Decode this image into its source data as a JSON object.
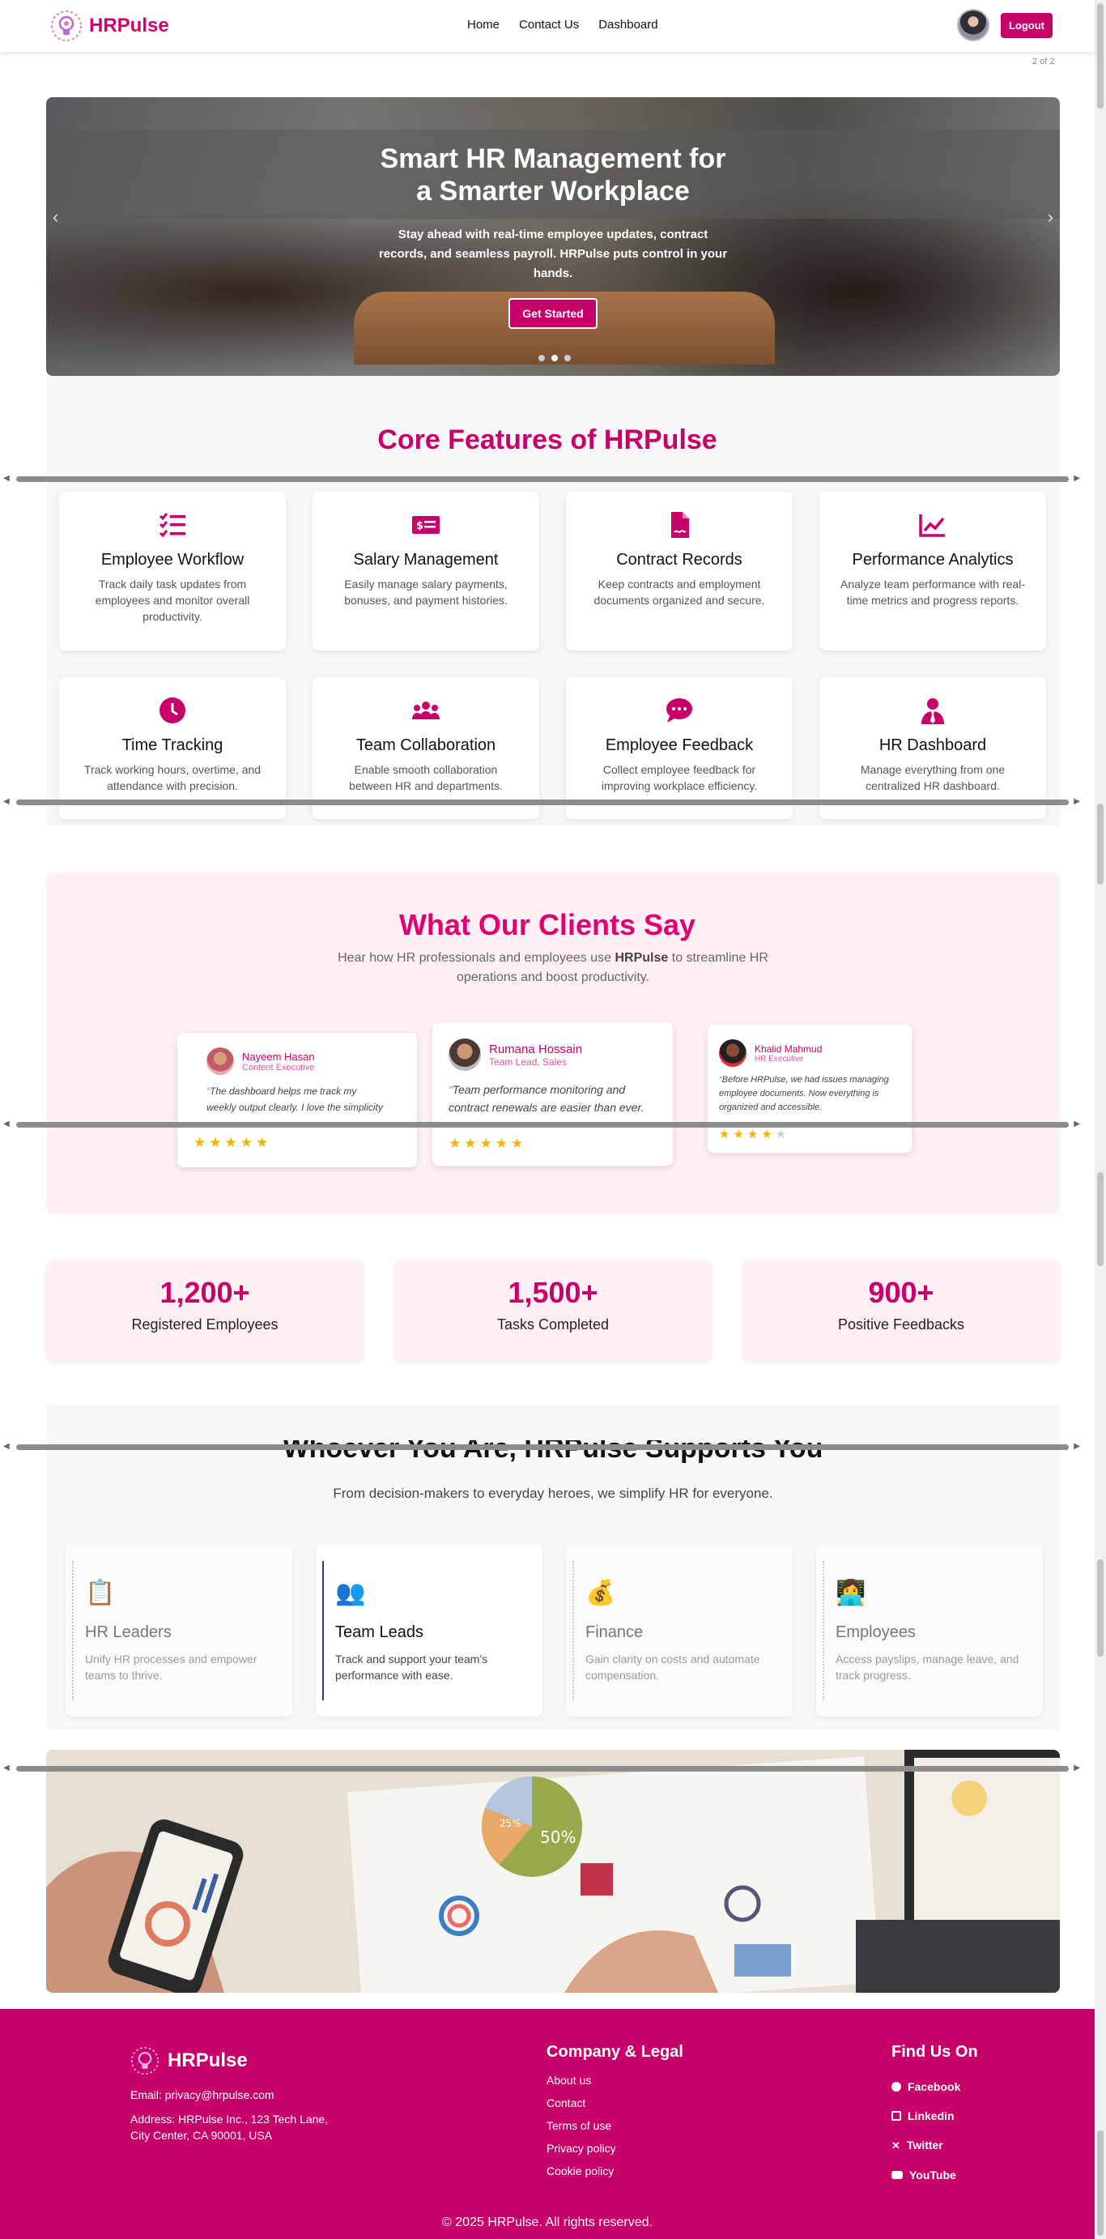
{
  "nav": {
    "brand": "HRPulse",
    "links": [
      "Home",
      "Contact Us",
      "Dashboard"
    ],
    "logout": "Logout",
    "page_indicator": "2 of 2"
  },
  "hero": {
    "title_line1": "Smart HR Management for",
    "title_line2": "a Smarter Workplace",
    "subtitle": "Stay ahead with real-time employee updates, contract records, and seamless payroll. HRPulse puts control in your hands.",
    "cta": "Get Started"
  },
  "features": {
    "title": "Core Features of HRPulse",
    "items": [
      {
        "title": "Employee Workflow",
        "desc": "Track daily task updates from employees and monitor overall productivity.",
        "icon": "tasks-icon"
      },
      {
        "title": "Salary Management",
        "desc": "Easily manage salary payments, bonuses, and payment histories.",
        "icon": "money-check-icon"
      },
      {
        "title": "Contract Records",
        "desc": "Keep contracts and employment documents organized and secure.",
        "icon": "file-contract-icon"
      },
      {
        "title": "Performance Analytics",
        "desc": "Analyze team performance with real-time metrics and progress reports.",
        "icon": "chart-line-icon"
      },
      {
        "title": "Time Tracking",
        "desc": "Track working hours, overtime, and attendance with precision.",
        "icon": "clock-icon"
      },
      {
        "title": "Team Collaboration",
        "desc": "Enable smooth collaboration between HR and departments.",
        "icon": "users-icon"
      },
      {
        "title": "Employee Feedback",
        "desc": "Collect employee feedback for improving workplace efficiency.",
        "icon": "comment-dots-icon"
      },
      {
        "title": "HR Dashboard",
        "desc": "Manage everything from one centralized HR dashboard.",
        "icon": "user-tie-icon"
      }
    ]
  },
  "testimonials": {
    "title": "What Our Clients Say",
    "subtitle_pre": "Hear how HR professionals and employees use ",
    "subtitle_brand": "HRPulse",
    "subtitle_post": " to streamline HR operations and boost productivity.",
    "items": [
      {
        "name": "Nayeem Hasan",
        "role": "Content Executive",
        "quote": "The dashboard helps me track my weekly output clearly. I love the simplicity and speed.",
        "stars": "★★★★★"
      },
      {
        "name": "Rumana Hossain",
        "role": "Team Lead, Sales",
        "quote": "Team performance monitoring and contract renewals are easier than ever. Absolutely essential.",
        "stars": "★★★★★"
      },
      {
        "name": "Khalid Mahmud",
        "role": "HR Executive",
        "quote": "Before HRPulse, we had issues managing employee documents. Now everything is organized and accessible.",
        "stars": "★★★★",
        "star_empty": "★"
      }
    ]
  },
  "stats": [
    {
      "number": "1,200+",
      "label": "Registered Employees"
    },
    {
      "number": "1,500+",
      "label": "Tasks Completed"
    },
    {
      "number": "900+",
      "label": "Positive Feedbacks"
    }
  ],
  "support": {
    "title": "Whoever You Are, HRPulse Supports You",
    "subtitle": "From decision-makers to everyday heroes, we simplify HR for everyone.",
    "items": [
      {
        "title": "HR Leaders",
        "desc": "Unify HR processes and empower teams to thrive.",
        "emoji": "📋"
      },
      {
        "title": "Team Leads",
        "desc": "Track and support your team's performance with ease.",
        "emoji": "👥"
      },
      {
        "title": "Finance",
        "desc": "Gain clarity on costs and automate compensation.",
        "emoji": "💰"
      },
      {
        "title": "Employees",
        "desc": "Access payslips, manage leave, and track progress.",
        "emoji": "👩‍💻"
      }
    ]
  },
  "photo": {
    "label_50": "50%",
    "label_25": "25%"
  },
  "footer": {
    "brand": "HRPulse",
    "email": "Email: privacy@hrpulse.com",
    "address_line1": "Address: HRPulse Inc., 123 Tech Lane,",
    "address_line2": "City Center, CA 90001, USA",
    "company_heading": "Company & Legal",
    "company_links": [
      "About us",
      "Contact",
      "Terms of use",
      "Privacy policy",
      "Cookie policy"
    ],
    "social_heading": "Find Us On",
    "social_links": [
      "Facebook",
      "Linkedin",
      "Twitter",
      "YouTube"
    ],
    "copyright": "© 2025 HRPulse. All rights reserved."
  },
  "colors": {
    "brand": "#c8006a",
    "accent_pink_bg": "#fff0f5",
    "star": "#f5b301",
    "active_border": "#3b2f9a"
  }
}
